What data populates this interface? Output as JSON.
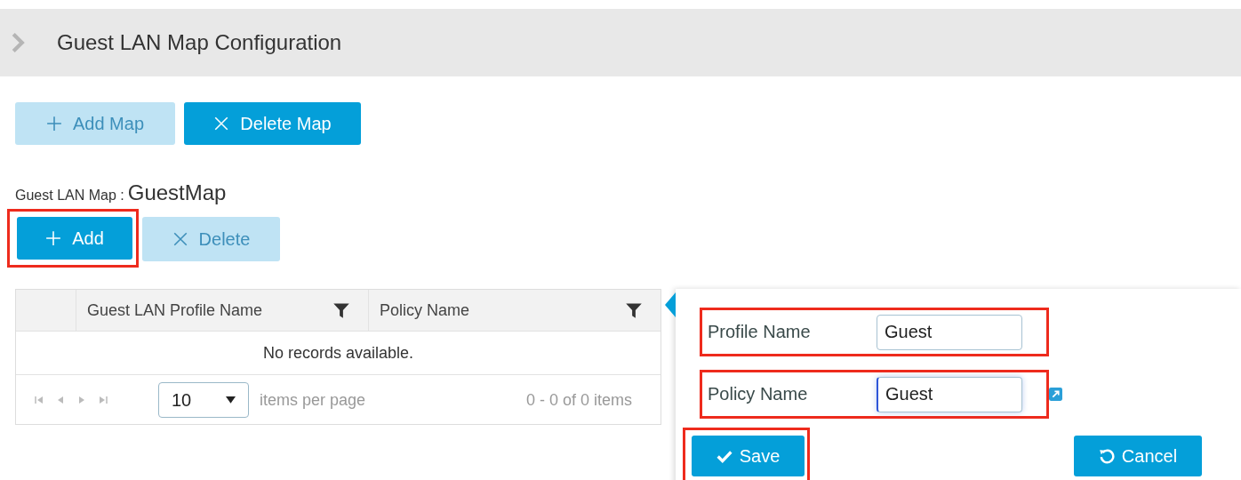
{
  "header": {
    "title": "Guest LAN Map Configuration"
  },
  "map_buttons": [
    {
      "label": "Add Map",
      "kind": "add",
      "disabled": true
    },
    {
      "label": "Delete Map",
      "kind": "delete",
      "disabled": false
    }
  ],
  "map_label": {
    "label": "Guest LAN Map :",
    "value": "GuestMap"
  },
  "entry_buttons": [
    {
      "label": "Add",
      "kind": "add",
      "disabled": false,
      "highlighted": true
    },
    {
      "label": "Delete",
      "kind": "delete",
      "disabled": true,
      "highlighted": false
    }
  ],
  "table": {
    "columns": [
      "Guest LAN Profile Name",
      "Policy Name"
    ],
    "empty_message": "No records available.",
    "pager": {
      "page_size": "10",
      "page_size_label": "items per page",
      "summary": "0 - 0 of 0 items"
    }
  },
  "panel": {
    "fields": [
      {
        "label": "Profile Name",
        "value": "Guest",
        "focused": false,
        "highlighted": true,
        "link": false
      },
      {
        "label": "Policy Name",
        "value": "Guest",
        "focused": true,
        "highlighted": true,
        "link": true
      }
    ],
    "buttons": [
      {
        "label": "Save",
        "kind": "save",
        "highlighted": true
      },
      {
        "label": "Cancel",
        "kind": "cancel",
        "highlighted": false
      }
    ]
  }
}
